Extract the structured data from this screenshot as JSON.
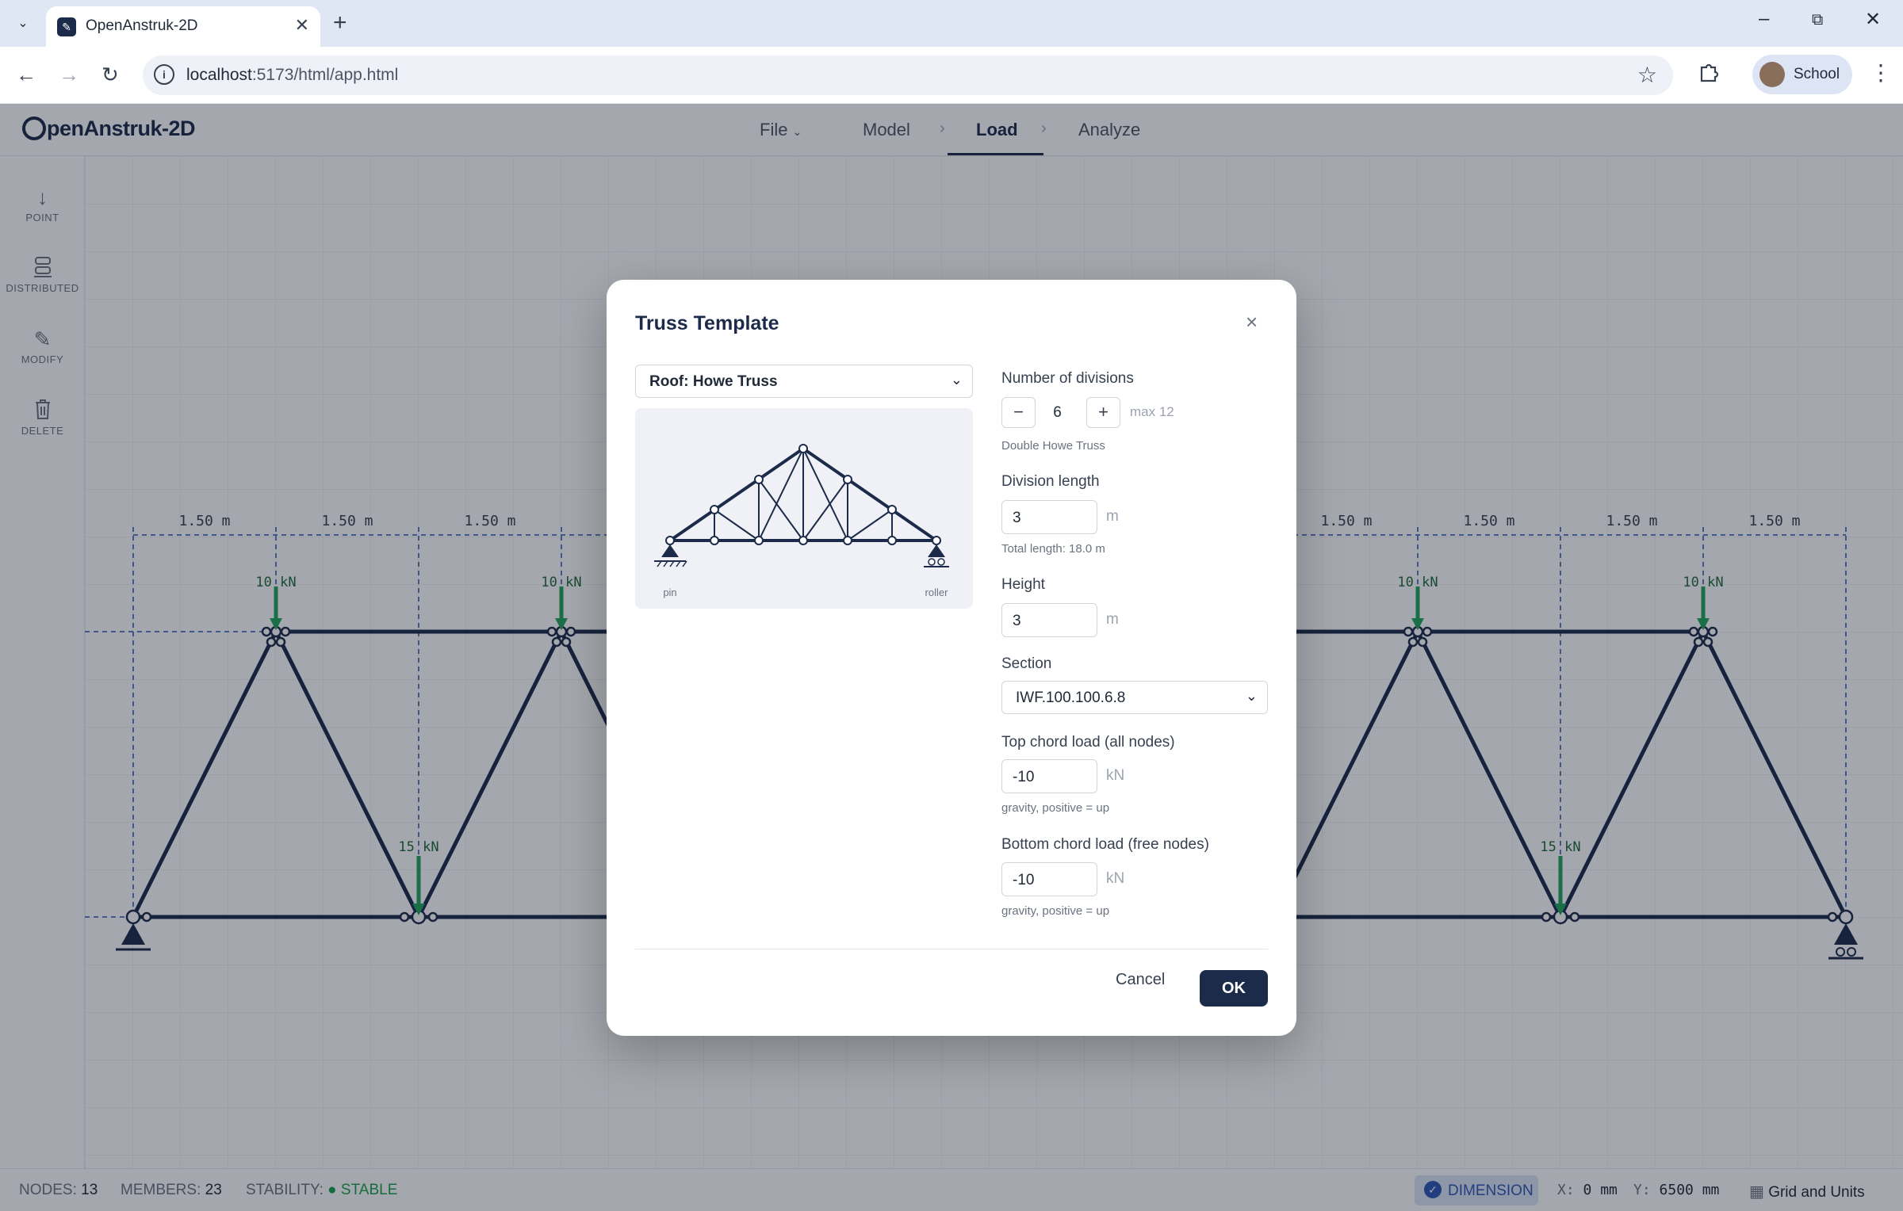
{
  "browser": {
    "tab_title": "OpenAnstruk-2D",
    "url_host": "localhost",
    "url_path": ":5173/html/app.html",
    "profile_name": "School"
  },
  "app": {
    "logo_text": "penAnstruk-2D",
    "menu": {
      "file": "File",
      "model": "Model",
      "load": "Load",
      "analyze": "Analyze"
    },
    "active_menu": "Load"
  },
  "sidebar": {
    "tools": [
      {
        "label": "POINT",
        "icon": "arrow-down-icon"
      },
      {
        "label": "DISTRIBUTED",
        "icon": "distributed-load-icon"
      },
      {
        "label": "MODIFY",
        "icon": "pencil-icon"
      },
      {
        "label": "DELETE",
        "icon": "trash-icon"
      }
    ]
  },
  "canvas": {
    "dimension_labels": [
      "1.50 m",
      "1.50 m",
      "1.50 m",
      "1.50 m",
      "1.50 m",
      "1.50 m",
      "1.50 m"
    ],
    "load_labels": {
      "top_left_1": "10 kN",
      "top_left_2": "10 kN",
      "bottom_left": "15 kN",
      "top_right_1": "10 kN",
      "top_right_2": "10 kN",
      "bottom_right": "15 kN"
    },
    "colors": {
      "member": "#1c2b4a",
      "load": "#22a55b",
      "dimension": "#2f56b5",
      "grid": "#e5e7eb"
    }
  },
  "status": {
    "nodes_label": "NODES:",
    "nodes_value": "13",
    "members_label": "MEMBERS:",
    "members_value": "23",
    "stability_label": "STABILITY:",
    "stability_value": "STABLE",
    "dimension_toggle": "DIMENSION",
    "x_label": "X:",
    "x_value": "0 mm",
    "y_label": "Y:",
    "y_value": "6500 mm",
    "grid_units": "Grid and Units"
  },
  "modal": {
    "title": "Truss Template",
    "template_select": "Roof: Howe Truss",
    "preview_left_label": "pin",
    "preview_right_label": "roller",
    "divisions": {
      "label": "Number of divisions",
      "value": "6",
      "max": "max 12",
      "hint": "Double Howe Truss"
    },
    "division_length": {
      "label": "Division length",
      "value": "3",
      "unit": "m",
      "hint": "Total length: 18.0 m"
    },
    "height": {
      "label": "Height",
      "value": "3",
      "unit": "m"
    },
    "section": {
      "label": "Section",
      "value": "IWF.100.100.6.8"
    },
    "top_chord_load": {
      "label": "Top chord load (all nodes)",
      "value": "-10",
      "unit": "kN",
      "hint": "gravity, positive = up"
    },
    "bottom_chord_load": {
      "label": "Bottom chord load (free nodes)",
      "value": "-10",
      "unit": "kN",
      "hint": "gravity, positive = up"
    },
    "cancel": "Cancel",
    "ok": "OK"
  }
}
